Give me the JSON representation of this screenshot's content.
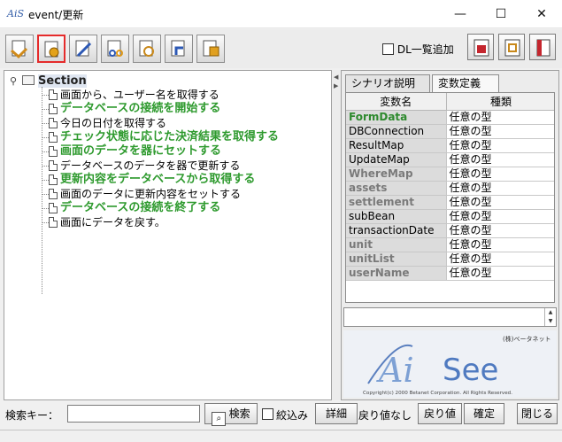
{
  "window": {
    "app_icon_text": "AiS",
    "title": "event/更新",
    "minimize": "—",
    "maximize": "☐",
    "close": "✕"
  },
  "toolbar": {
    "dl_checkbox_label": "DL一覧追加"
  },
  "tree": {
    "root": "Section",
    "items": [
      {
        "text": "画面から、ユーザー名を取得する",
        "style": "black"
      },
      {
        "text": "データベースの接続を開始する",
        "style": "green"
      },
      {
        "text": "今日の日付を取得する",
        "style": "black"
      },
      {
        "text": "チェック状態に応じた決済結果を取得する",
        "style": "green"
      },
      {
        "text": "画面のデータを器にセットする",
        "style": "green"
      },
      {
        "text": "データベースのデータを器で更新する",
        "style": "black"
      },
      {
        "text": "更新内容をデータベースから取得する",
        "style": "green"
      },
      {
        "text": "画面のデータに更新内容をセットする",
        "style": "black"
      },
      {
        "text": "データベースの接続を終了する",
        "style": "green"
      },
      {
        "text": "画面にデータを戻す。",
        "style": "black"
      }
    ]
  },
  "tabs": [
    {
      "label": "シナリオ説明",
      "active": false
    },
    {
      "label": "変数定義",
      "active": true
    }
  ],
  "var_table": {
    "headers": [
      "変数名",
      "種類"
    ],
    "rows": [
      {
        "name": "FormData",
        "type": "任意の型",
        "style": "green"
      },
      {
        "name": "DBConnection",
        "type": "任意の型",
        "style": "black"
      },
      {
        "name": "ResultMap",
        "type": "任意の型",
        "style": "black"
      },
      {
        "name": "UpdateMap",
        "type": "任意の型",
        "style": "black"
      },
      {
        "name": "WhereMap",
        "type": "任意の型",
        "style": "gray"
      },
      {
        "name": "assets",
        "type": "任意の型",
        "style": "gray"
      },
      {
        "name": "settlement",
        "type": "任意の型",
        "style": "gray"
      },
      {
        "name": "subBean",
        "type": "任意の型",
        "style": "black"
      },
      {
        "name": "transactionDate",
        "type": "任意の型",
        "style": "black"
      },
      {
        "name": "unit",
        "type": "任意の型",
        "style": "gray"
      },
      {
        "name": "unitList",
        "type": "任意の型",
        "style": "gray"
      },
      {
        "name": "userName",
        "type": "任意の型",
        "style": "gray"
      }
    ]
  },
  "logo": {
    "company": "(株)ベータネット",
    "mark_ai": "Ai",
    "mark_see": "See",
    "copyright": "Copyright(c) 2000 Betanet Corporation. All Rights Reserved."
  },
  "bottom": {
    "search_label": "検索キー：",
    "search_value": "",
    "search_button": "検索",
    "filter_label": "絞込み",
    "detail_button": "詳細",
    "no_return_label": "戻り値なし",
    "return_button": "戻り値",
    "confirm_button": "確定",
    "close_button": "閉じる"
  },
  "colors": {
    "green_text": "#2e9a2e",
    "gray_text": "#7a7a7a",
    "active_border": "#e52b2b"
  }
}
